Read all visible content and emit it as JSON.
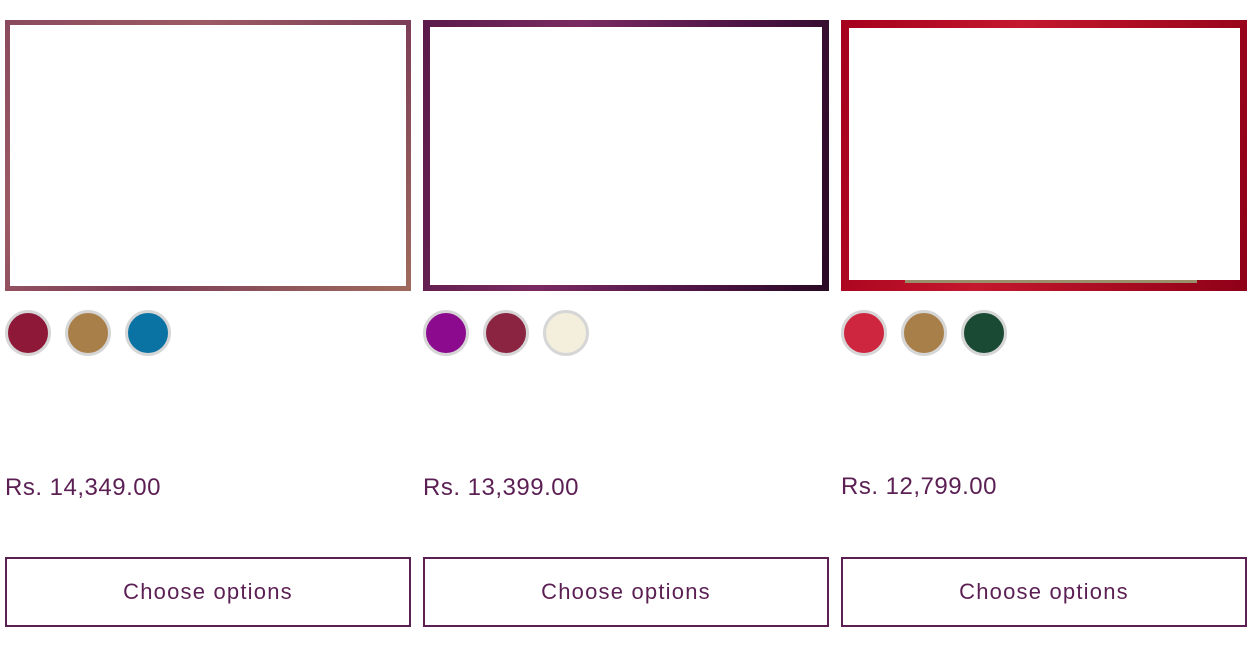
{
  "products": [
    {
      "price": "Rs. 14,349.00",
      "button_label": "Choose options",
      "swatches": [
        {
          "color": "#8e1838"
        },
        {
          "color": "#a87f48"
        },
        {
          "color": "#0b73a4"
        }
      ]
    },
    {
      "price": "Rs. 13,399.00",
      "button_label": "Choose options",
      "swatches": [
        {
          "color": "#8b0a8e"
        },
        {
          "color": "#8a2440"
        },
        {
          "color": "#f4efdc"
        }
      ]
    },
    {
      "price": "Rs. 12,799.00",
      "button_label": "Choose options",
      "swatches": [
        {
          "color": "#cf2640"
        },
        {
          "color": "#a87f48"
        },
        {
          "color": "#1a4a33"
        }
      ]
    }
  ]
}
